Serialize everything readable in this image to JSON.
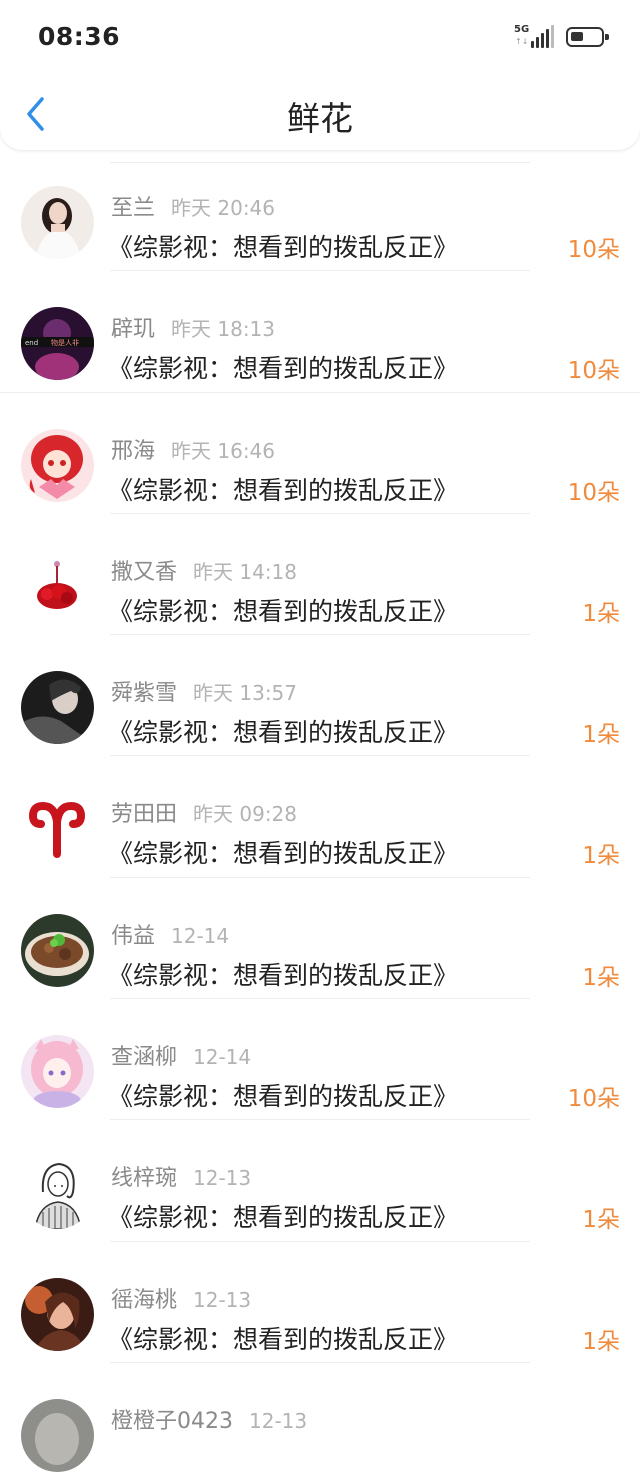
{
  "status_bar": {
    "time": "08:36",
    "network": "5G"
  },
  "header": {
    "title": "鲜花"
  },
  "colors": {
    "accent_back": "#2f8fe8",
    "count": "#f08a3c"
  },
  "items": [
    {
      "name": "至兰",
      "time": "昨天 20:46",
      "book": "《综影视：想看到的拨乱反正》",
      "count": "10朵",
      "avatar": "avatar-photo-girl-white-dress"
    },
    {
      "name": "辟玑",
      "time": "昨天 18:13",
      "book": "《综影视：想看到的拨乱反正》",
      "count": "10朵",
      "avatar": "avatar-dark-purple-text"
    },
    {
      "name": "邢海",
      "time": "昨天 16:46",
      "book": "《综影视：想看到的拨乱反正》",
      "count": "10朵",
      "avatar": "avatar-red-hair-anime"
    },
    {
      "name": "撒又香",
      "time": "昨天 14:18",
      "book": "《综影视：想看到的拨乱反正》",
      "count": "1朵",
      "avatar": "avatar-red-rose-figure"
    },
    {
      "name": "舜紫雪",
      "time": "昨天 13:57",
      "book": "《综影视：想看到的拨乱反正》",
      "count": "1朵",
      "avatar": "avatar-dark-portrait"
    },
    {
      "name": "劳田田",
      "time": "昨天 09:28",
      "book": "《综影视：想看到的拨乱反正》",
      "count": "1朵",
      "avatar": "avatar-aries-symbol"
    },
    {
      "name": "伟益",
      "time": "12-14",
      "book": "《综影视：想看到的拨乱反正》",
      "count": "1朵",
      "avatar": "avatar-food-bowl"
    },
    {
      "name": "查涵柳",
      "time": "12-14",
      "book": "《综影视：想看到的拨乱反正》",
      "count": "10朵",
      "avatar": "avatar-pink-anime"
    },
    {
      "name": "线梓琬",
      "time": "12-13",
      "book": "《综影视：想看到的拨乱反正》",
      "count": "1朵",
      "avatar": "avatar-sketch-girl"
    },
    {
      "name": "徭海桃",
      "time": "12-13",
      "book": "《综影视：想看到的拨乱反正》",
      "count": "1朵",
      "avatar": "avatar-warm-portrait"
    },
    {
      "name": "橙橙子0423",
      "time": "12-13",
      "book": "",
      "count": "",
      "avatar": "avatar-grey-partial"
    }
  ]
}
